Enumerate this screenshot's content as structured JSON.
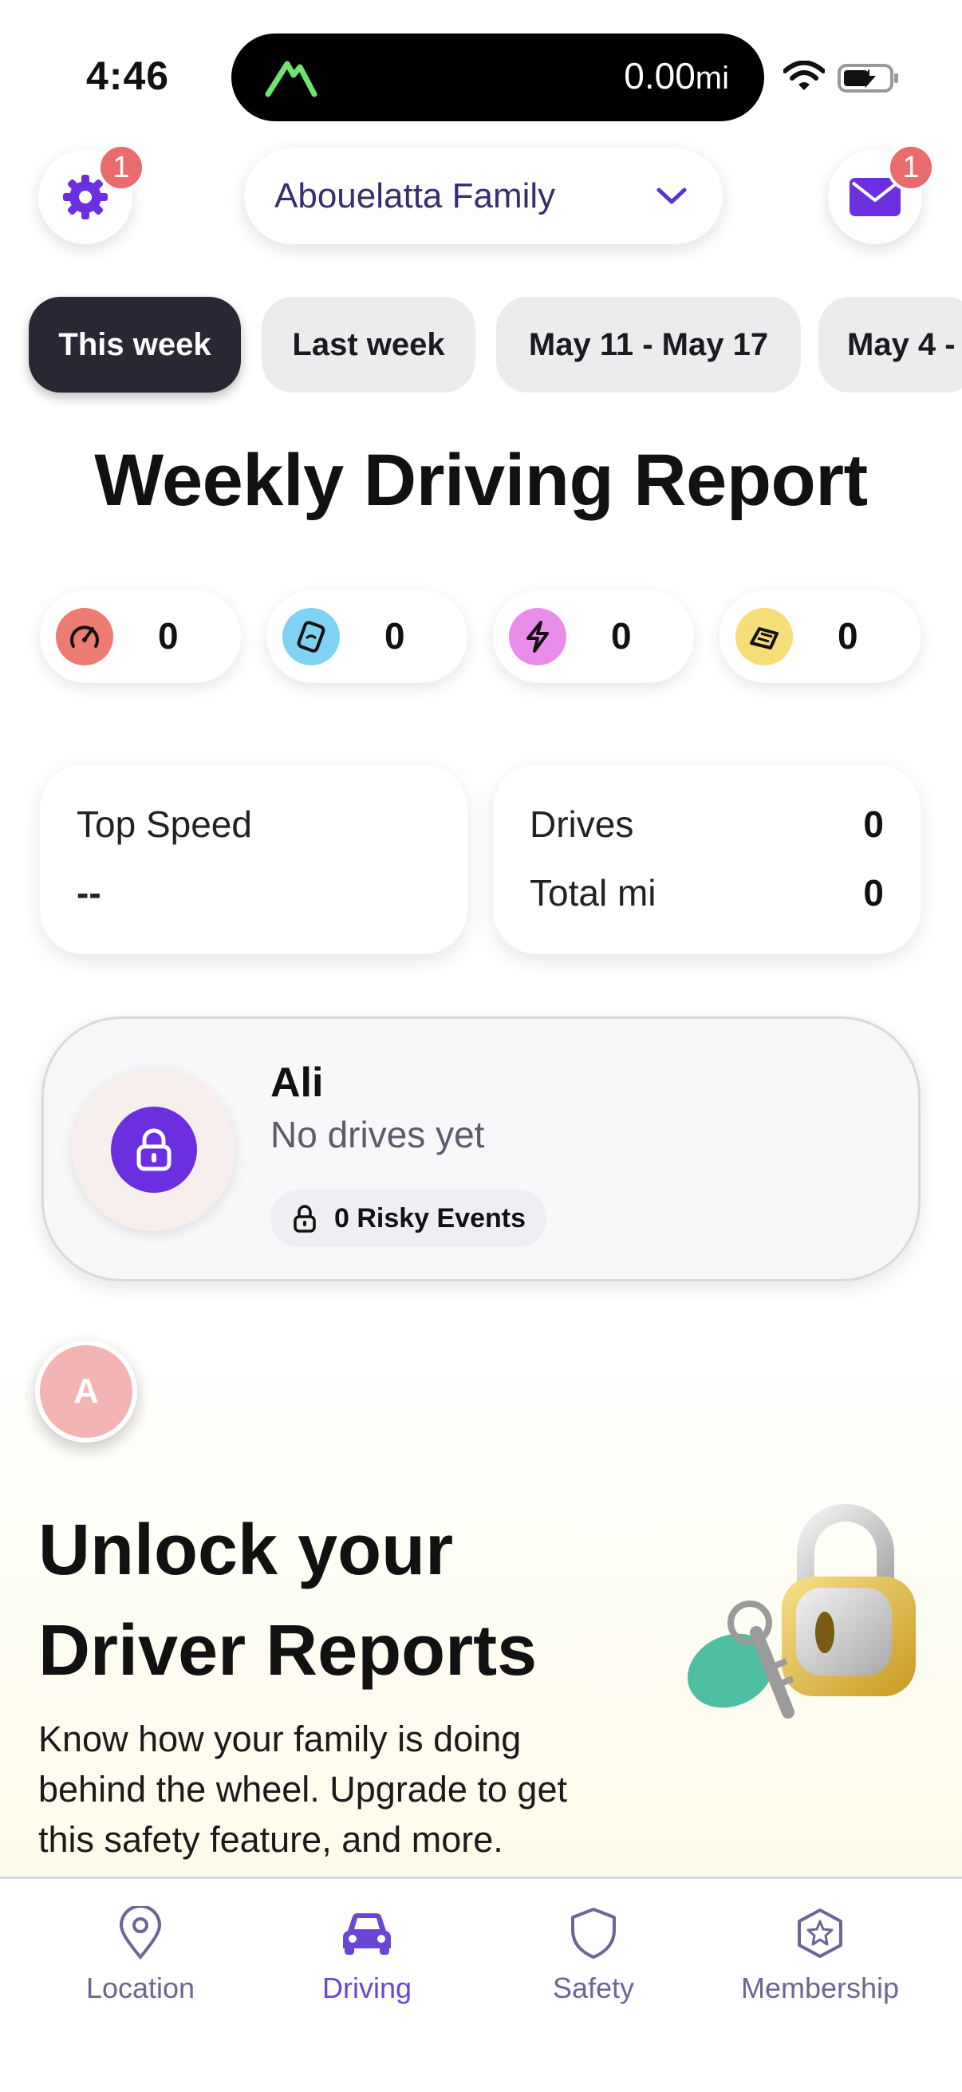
{
  "status_bar": {
    "time": "4:46",
    "trip_distance": "0.00",
    "trip_unit": "mi"
  },
  "header": {
    "settings_badge": "1",
    "family_name": "Abouelatta Family",
    "mail_badge": "1"
  },
  "week_tabs": [
    {
      "label": "This week",
      "active": true
    },
    {
      "label": "Last week",
      "active": false
    },
    {
      "label": "May 11 - May 17",
      "active": false
    },
    {
      "label": "May 4 -",
      "active": false
    }
  ],
  "report": {
    "title": "Weekly Driving Report",
    "events": [
      {
        "icon": "speedometer-icon",
        "value": "0",
        "color": "#ee7b72"
      },
      {
        "icon": "phone-usage-icon",
        "value": "0",
        "color": "#7fd3f2"
      },
      {
        "icon": "rapid-acceleration-icon",
        "value": "0",
        "color": "#e98ce9"
      },
      {
        "icon": "hard-braking-icon",
        "value": "0",
        "color": "#f6dd78"
      }
    ],
    "top_speed_label": "Top Speed",
    "top_speed_value": "--",
    "drives_label": "Drives",
    "drives_value": "0",
    "total_label": "Total mi",
    "total_value": "0"
  },
  "driver": {
    "name": "Ali",
    "status": "No drives yet",
    "risky_events": "0 Risky Events",
    "avatar_initial": "A"
  },
  "upsell": {
    "title_line1": "Unlock your",
    "title_line2": "Driver Reports",
    "line1": "Know how your family is doing",
    "line2": "behind the wheel. Upgrade to get",
    "line3": "this safety feature, and more."
  },
  "nav": {
    "location": "Location",
    "driving": "Driving",
    "safety": "Safety",
    "membership": "Membership"
  },
  "colors": {
    "accent": "#6b2fe0",
    "active_tab": "#2a2633",
    "badge": "#ea6b6b"
  }
}
